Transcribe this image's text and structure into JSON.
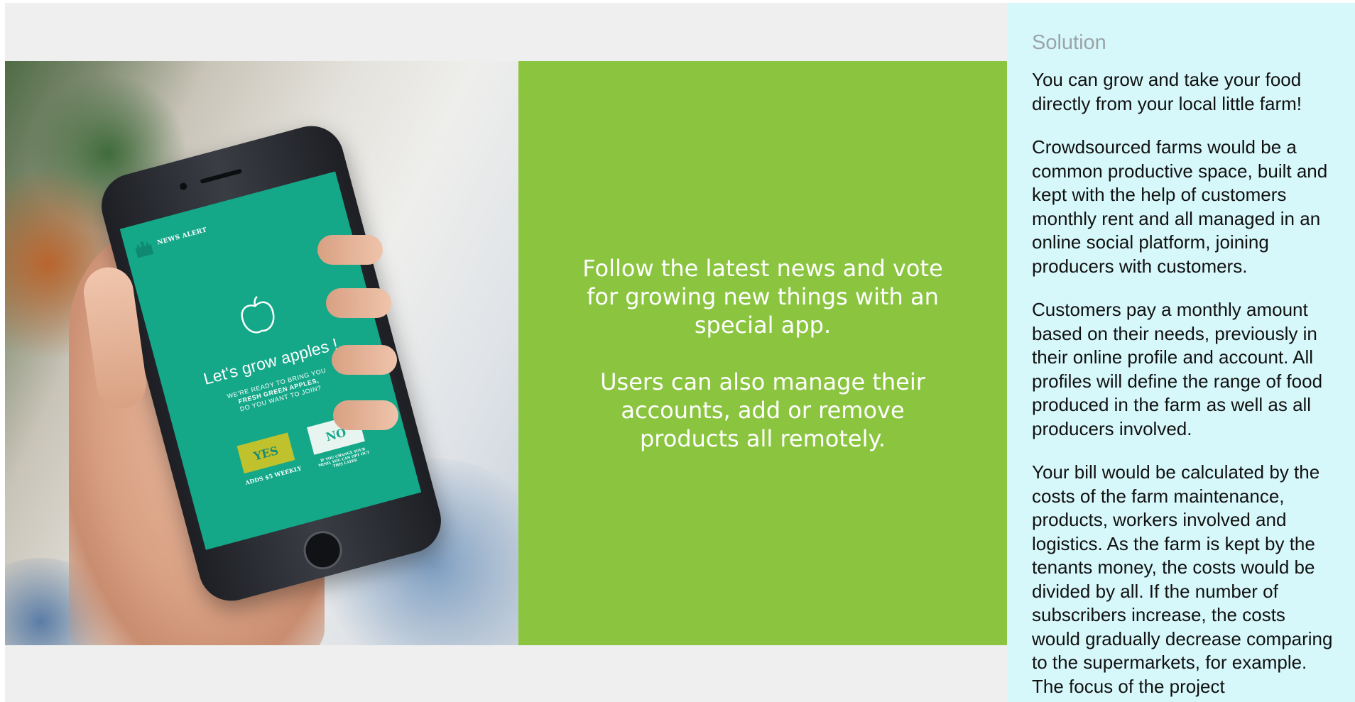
{
  "slide": {
    "phone_screen": {
      "header": "NEWS ALERT",
      "title": "Let's grow apples !",
      "subtitle_line1": "WE'RE READY TO BRING YOU",
      "subtitle_line2": "FRESH GREEN APPLES,",
      "subtitle_line3": "DO YOU WANT TO JOIN?",
      "yes_label": "YES",
      "no_label": "NO",
      "yes_note": "ADDS $5 WEEKLY",
      "no_note": "IF YOU CHANGE YOUR MIND, YOU CAN OPT OUT THIS LATER"
    },
    "caption_paragraph1": "Follow the latest news and vote for growing new things with an special app.",
    "caption_paragraph2": "Users can also manage their accounts, add or remove products all remotely."
  },
  "sidebar": {
    "title": "Solution",
    "paragraphs": [
      "You can grow and take your food directly from your local little farm!",
      "Crowdsourced farms would be a common productive space, built and kept with the help of customers monthly rent and all managed in an online social platform, joining producers with customers.",
      "Customers pay a monthly amount based on their needs, previously in their online profile and account. All profiles will define the range of food produced in the farm as well as all producers involved.",
      "Your bill would be calculated by the costs of the farm maintenance, products, workers involved and logistics. As the farm is kept by the tenants money, the costs would be divided by all. If the number of subscribers increase, the costs would gradually decrease comparing to the supermarkets, for example. The focus of the project"
    ]
  },
  "colors": {
    "viewer_background": "#efefef",
    "caption_panel": "#8bc540",
    "phone_screen": "#14a889",
    "sidebar_background": "#d7f8fb",
    "sidebar_title": "#9aa4a8"
  }
}
